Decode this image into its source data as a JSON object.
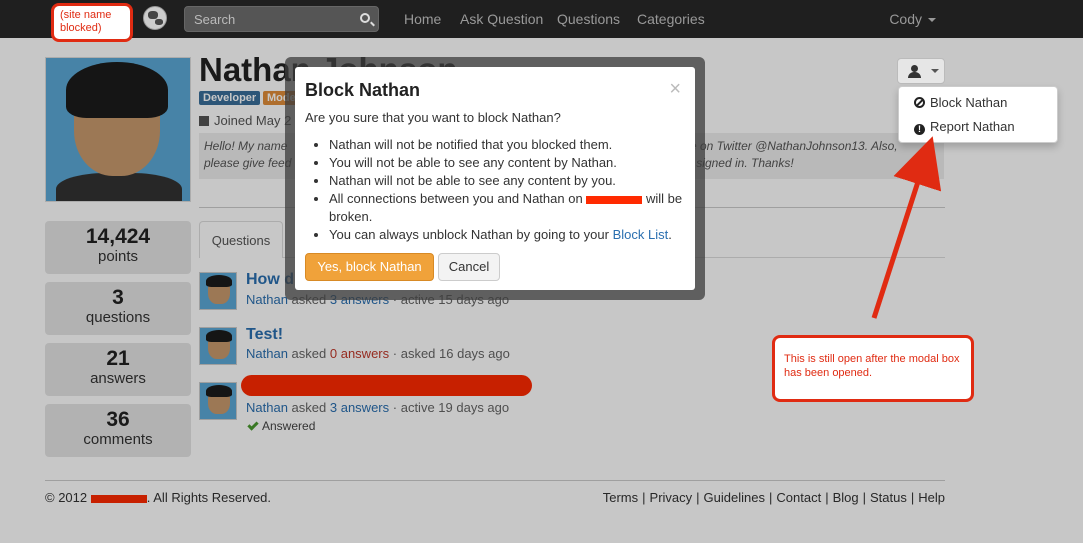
{
  "navbar": {
    "site_name_blocked": "(site name blocked)",
    "search_placeholder": "Search",
    "links": [
      "Home",
      "Ask Question",
      "Questions",
      "Categories"
    ],
    "user": "Cody"
  },
  "profile": {
    "name": "Nathan Johnson",
    "badges": [
      "Developer",
      "Mode"
    ],
    "joined": "Joined May 2",
    "bio_left_1": "Hello! My name",
    "bio_left_2": "please give feed",
    "bio_right_1": "me on Twitter @NathanJohnson13. Also,",
    "bio_right_2": "'re signed in. Thanks!"
  },
  "stats": [
    {
      "number": "14,424",
      "label": "points"
    },
    {
      "number": "3",
      "label": "questions"
    },
    {
      "number": "21",
      "label": "answers"
    },
    {
      "number": "36",
      "label": "comments"
    }
  ],
  "tabs": [
    "Questions"
  ],
  "questions": [
    {
      "title": "How d",
      "user": "Nathan",
      "asked": "asked",
      "answers": "3 answers",
      "when": "active 15 days ago"
    },
    {
      "title": "Test!",
      "user": "Nathan",
      "asked": "asked",
      "answers": "0 answers",
      "when": "asked 16 days ago"
    },
    {
      "title": "",
      "user": "Nathan",
      "asked": "asked",
      "answers": "3 answers",
      "when": "active 19 days ago",
      "status": "Answered"
    }
  ],
  "footer": {
    "copyright_prefix": "© 2012",
    "copyright_suffix": ". All Rights Reserved.",
    "links": [
      "Terms",
      "Privacy",
      "Guidelines",
      "Contact",
      "Blog",
      "Status",
      "Help"
    ]
  },
  "dropdown": {
    "items": [
      "Block Nathan",
      "Report Nathan"
    ]
  },
  "modal": {
    "title": "Block Nathan",
    "close": "×",
    "question": "Are you sure that you want to block Nathan?",
    "bullets": [
      "Nathan will not be notified that you blocked them.",
      "You will not be able to see any content by Nathan.",
      "Nathan will not be able to see any content by you.",
      "All connections between you and Nathan on",
      "will be broken.",
      "You can always unblock Nathan by going to your",
      "Block List",
      "."
    ],
    "confirm": "Yes, block Nathan",
    "cancel": "Cancel"
  },
  "callout": {
    "text": "This is still open after the modal box has been opened."
  },
  "colors": {
    "accent": "#2a6fb0",
    "annotation_red": "#e02b12",
    "confirm_orange": "#f0a23a"
  }
}
